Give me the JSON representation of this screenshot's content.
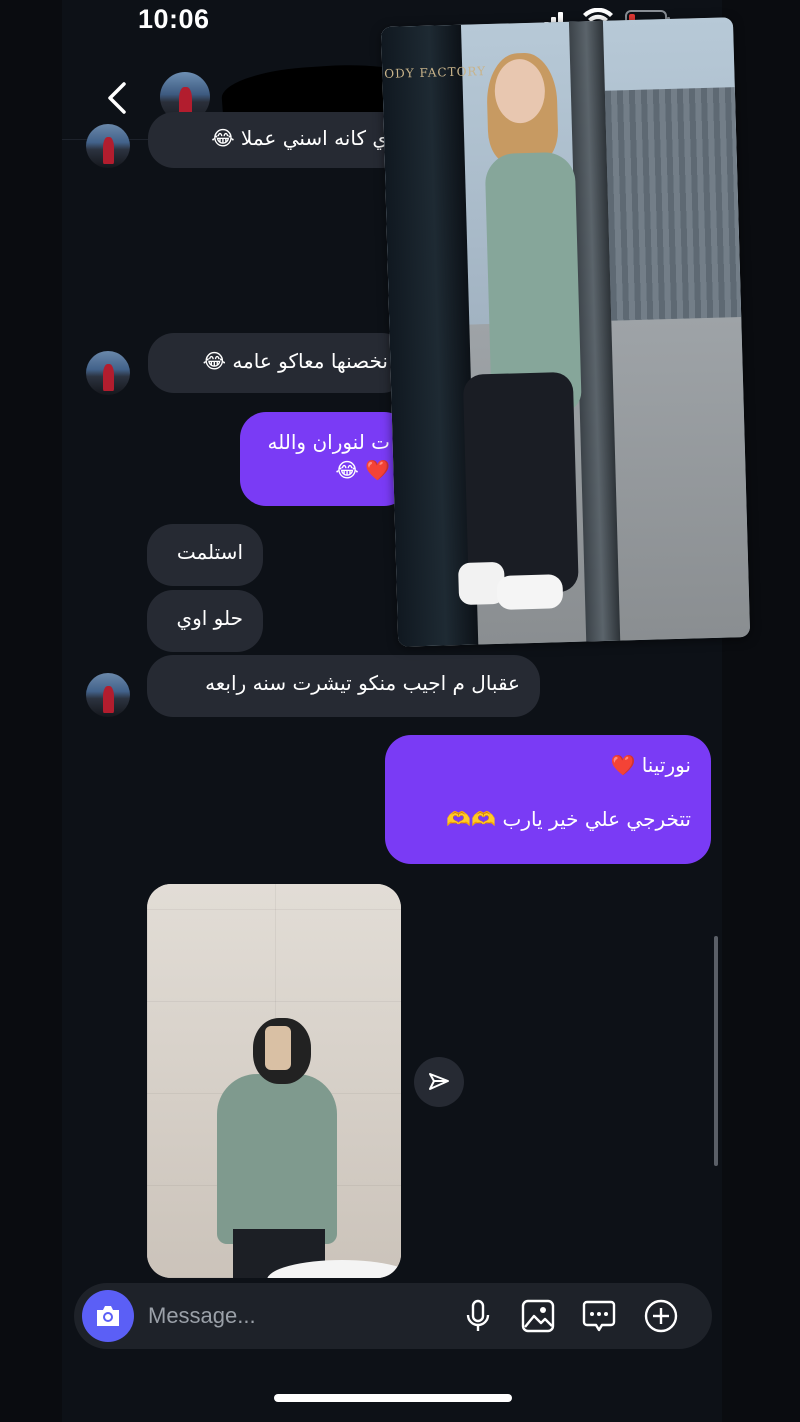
{
  "status_bar": {
    "time": "10:06"
  },
  "header": {
    "back_icon": "chevron-left-icon"
  },
  "messages": [
    {
      "id": "m1",
      "direction": "incoming",
      "text": "ي كانه اسني عملا 😂",
      "partially_hidden": true
    },
    {
      "id": "m2",
      "direction": "incoming",
      "text": "نخصنها معاكو عامه 😂",
      "partially_hidden": true
    },
    {
      "id": "m3",
      "direction": "outgoing",
      "lines": [
        "ت لنوران والله",
        "❤️ 😂"
      ],
      "partially_hidden": true
    },
    {
      "id": "m4",
      "direction": "incoming",
      "text": "استلمت"
    },
    {
      "id": "m5",
      "direction": "incoming",
      "text": "حلو اوي"
    },
    {
      "id": "m6",
      "direction": "incoming",
      "text": "عقبال م اجيب منكو تيشرت سنه رابعه"
    },
    {
      "id": "m7",
      "direction": "outgoing",
      "lines": [
        "نورتينا ❤️",
        "تتخرجي علي خير يارب 🫶🫶"
      ]
    }
  ],
  "overlay_photo": {
    "brand_text": "ODY FACTORY"
  },
  "composer": {
    "placeholder": "Message...",
    "value": ""
  },
  "colors": {
    "background": "#0d1117",
    "incoming_bubble": "#262a33",
    "outgoing_bubble": "#7a3bf5",
    "camera_button": "#5b5ff6"
  }
}
